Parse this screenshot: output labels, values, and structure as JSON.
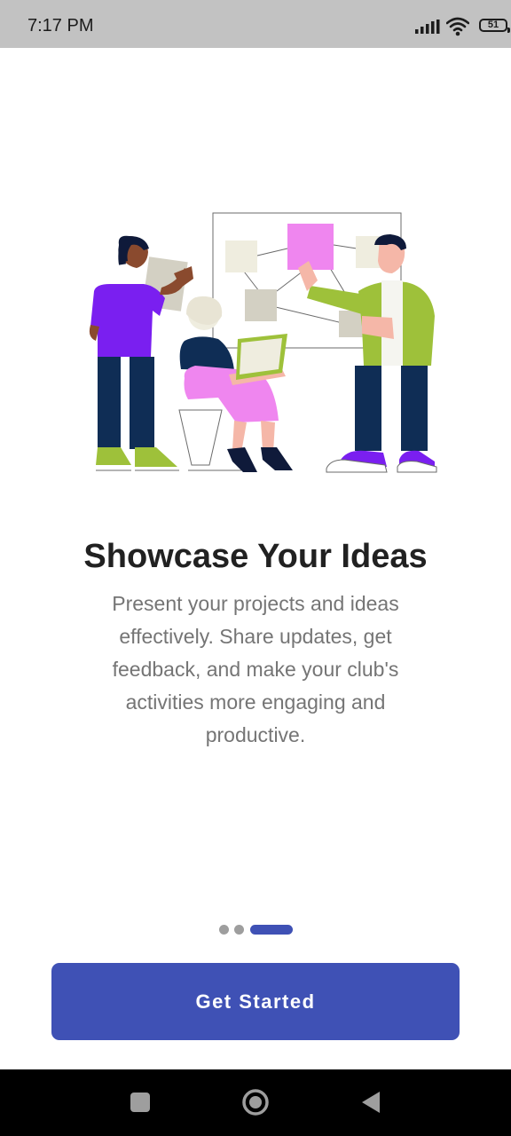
{
  "status_bar": {
    "time": "7:17 PM",
    "battery": "51",
    "icons": [
      "signal-icon",
      "wifi-icon",
      "battery-icon"
    ]
  },
  "onboarding": {
    "illustration": "people-presenting-ideas-illustration",
    "title": "Showcase Your Ideas",
    "description": "Present your projects and ideas effectively. Share updates, get feedback, and make your club's activities more engaging and productive.",
    "page_indicator": {
      "total": 3,
      "current": 3
    },
    "cta_label": "Get Started"
  },
  "nav_bar": {
    "buttons": [
      "recent-apps-button",
      "home-button",
      "back-button"
    ]
  },
  "colors": {
    "accent": "#3f51b5",
    "status_bar": "#c2c2c2",
    "title": "#212121",
    "description": "#757575",
    "inactive_dot": "#9e9e9e"
  }
}
